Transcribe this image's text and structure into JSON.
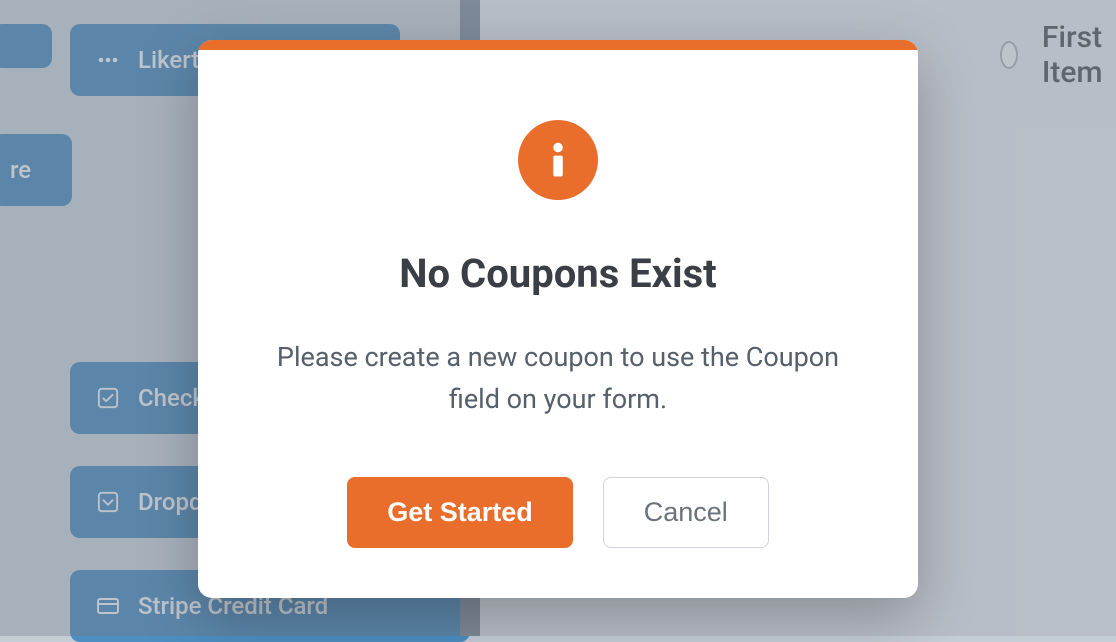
{
  "sidebar": {
    "items": [
      {
        "label": "Likert"
      },
      {
        "label": "re"
      },
      {
        "label": "Check"
      },
      {
        "label": "Dropdown"
      },
      {
        "label": "Stripe Credit Card"
      }
    ]
  },
  "preview": {
    "first_item_label": "First Item"
  },
  "modal": {
    "title": "No Coupons Exist",
    "description": "Please create a new coupon to use the Coupon field on your form.",
    "primary_button": "Get Started",
    "secondary_button": "Cancel"
  },
  "colors": {
    "accent": "#e96d2b",
    "sidebar_block": "#4d8fc2"
  }
}
